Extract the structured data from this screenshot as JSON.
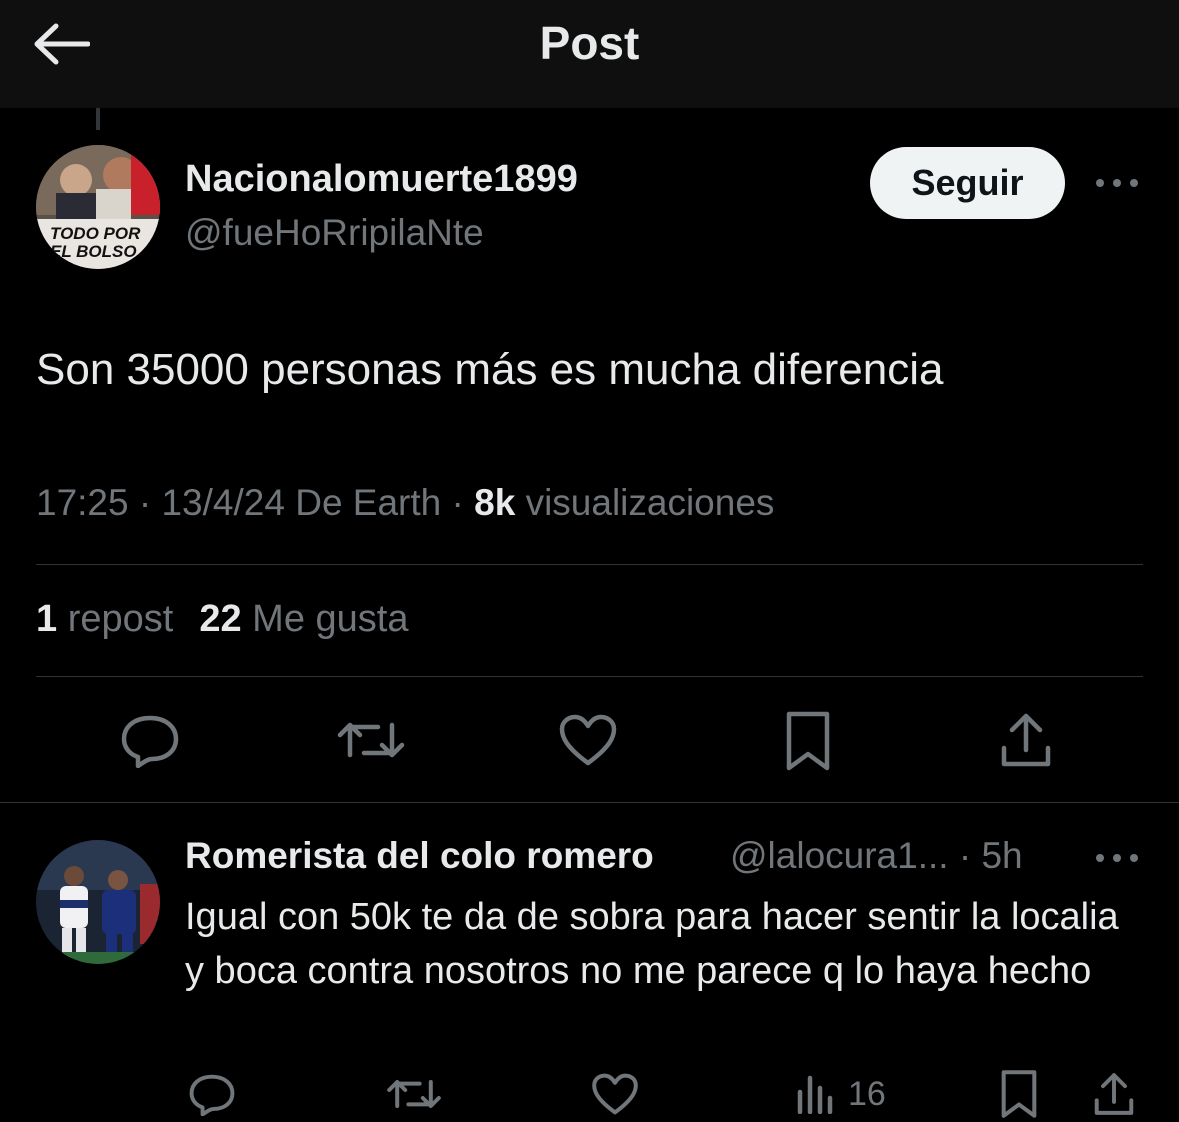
{
  "header": {
    "title": "Post",
    "back_icon": "arrow-left-icon"
  },
  "post": {
    "display_name": "Nacionalomuerte1899",
    "handle": "@fueHoRripilaNte",
    "avatar_text_line1": "TODO POR",
    "avatar_text_line2": "EL BOLSO",
    "follow_label": "Seguir",
    "text": "Son 35000 personas más es mucha diferencia",
    "time": "17:25",
    "date": "13/4/24",
    "source": "De Earth",
    "views": "8k",
    "views_label": "visualizaciones",
    "reposts": "1",
    "reposts_label": "repost",
    "likes": "22",
    "likes_label": "Me gusta"
  },
  "reply": {
    "display_name": "Romerista del colo romero",
    "handle": "@lalocura1...",
    "age": "5h",
    "text": "Igual con 50k te da de sobra para hacer sentir la localia y boca contra nosotros no me parece q lo haya hecho",
    "views": "16"
  },
  "colors": {
    "background": "#000000",
    "text": "#e7e9ea",
    "muted": "#71767b",
    "divider": "#2f3336",
    "follow_bg": "#eff3f4"
  }
}
